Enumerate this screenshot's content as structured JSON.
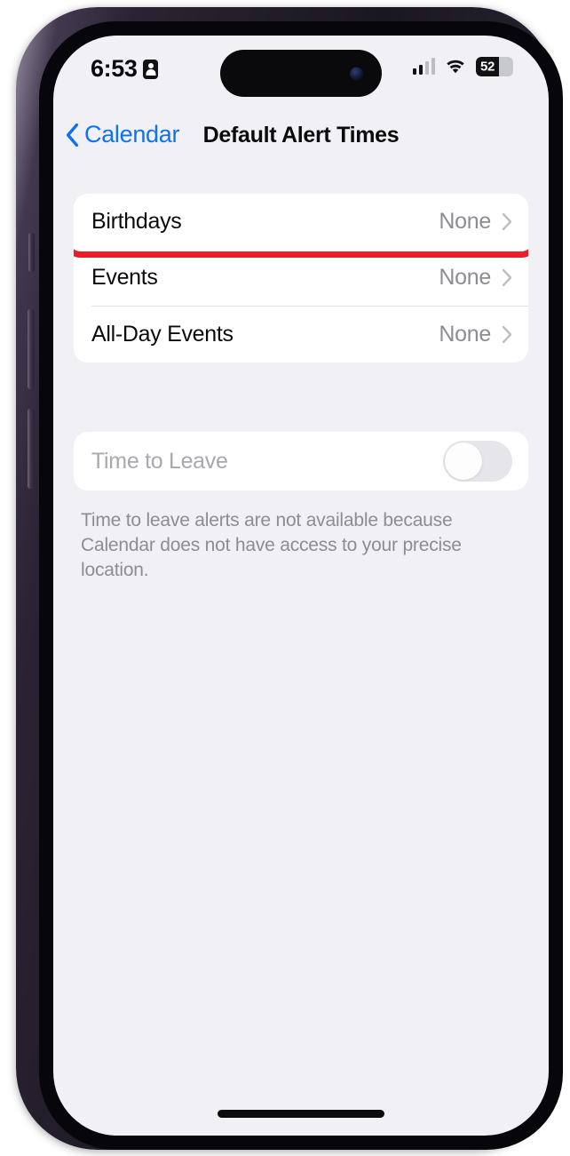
{
  "status_bar": {
    "time": "6:53",
    "time_icon": "contact-card-icon",
    "cellular_icon": "cellular-signal-icon",
    "wifi_icon": "wifi-icon",
    "battery_level": "52",
    "battery_percent": 52
  },
  "nav": {
    "back_label": "Calendar",
    "back_icon": "chevron-left-icon",
    "title": "Default Alert Times"
  },
  "alerts": {
    "rows": [
      {
        "label": "Birthdays",
        "value": "None",
        "chevron": "chevron-right-icon",
        "highlighted": true
      },
      {
        "label": "Events",
        "value": "None",
        "chevron": "chevron-right-icon",
        "highlighted": false
      },
      {
        "label": "All-Day Events",
        "value": "None",
        "chevron": "chevron-right-icon",
        "highlighted": false
      }
    ]
  },
  "time_to_leave": {
    "label": "Time to Leave",
    "enabled": false,
    "toggle_state": "off",
    "footer": "Time to leave alerts are not available because Calendar does not have access to your precise location."
  },
  "annotation": {
    "target": "Birthdays",
    "color": "#ee1c26"
  },
  "colors": {
    "accent_blue": "#1072ef",
    "annotation_red": "#ee1c26",
    "background": "#f1f1f5",
    "card": "#ffffff",
    "secondary_text": "#8c8c92",
    "disabled_text": "#a8a8ad"
  }
}
